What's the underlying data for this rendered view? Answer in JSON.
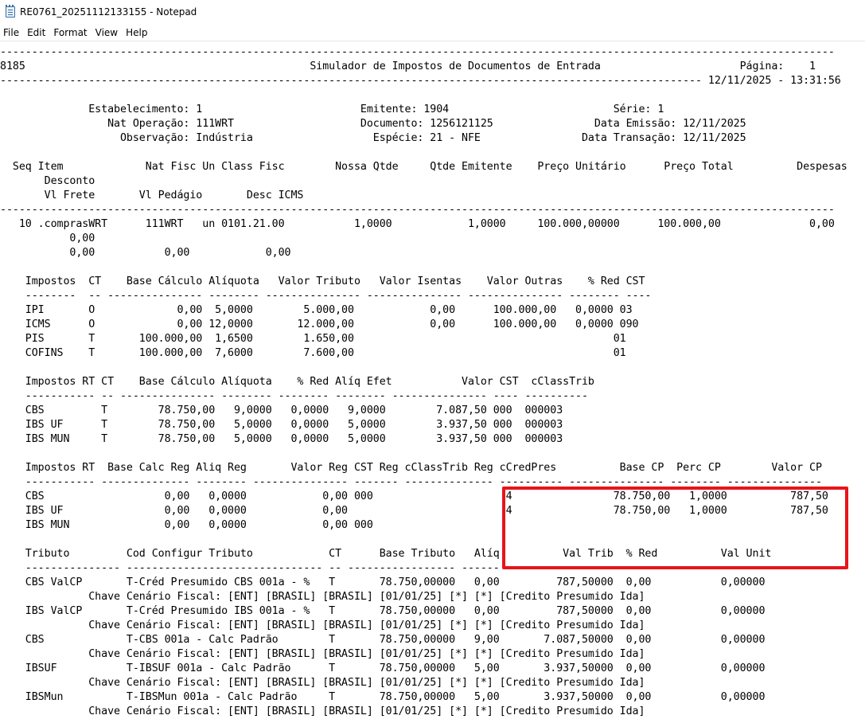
{
  "window": {
    "title": "RE0761_20251112133155 - Notepad"
  },
  "menu": {
    "items": [
      "File",
      "Edit",
      "Format",
      "View",
      "Help"
    ]
  },
  "document": {
    "lines": [
      "------------------------------------------------------------------------------------------------------------------------------------",
      "8185                                             Simulador de Impostos de Documentos de Entrada                      Página:    1",
      "--------------------------------------------------------------------------------------------------------------- 12/11/2025 - 13:31:56",
      "",
      "              Estabelecimento: 1                         Emitente: 1904                          Série: 1",
      "                 Nat Operação: 111WRT                    Documento: 1256121125                Data Emissão: 12/11/2025",
      "                   Observação: Indústria                   Espécie: 21 - NFE                Data Transação: 12/11/2025",
      "",
      "  Seq Item             Nat Fisc Un Class Fisc        Nossa Qtde     Qtde Emitente    Preço Unitário      Preço Total          Despesas",
      "       Desconto",
      "       Vl Frete       Vl Pedágio       Desc ICMS",
      "------------------------------------------------------------------------------------------------------------------------------------",
      "   10 .comprasWRT      111WRT   un 0101.21.00           1,0000            1,0000     100.000,00000      100.000,00              0,00",
      "           0,00",
      "           0,00           0,00            0,00",
      "",
      "    Impostos  CT    Base Cálculo Alíquota   Valor Tributo   Valor Isentas    Valor Outras    % Red CST",
      "    --------  -- --------------- -------- --------------- --------------- --------------- -------- ----",
      "    IPI       O             0,00  5,0000        5.000,00            0,00      100.000,00   0,0000 03",
      "    ICMS      O             0,00 12,0000       12.000,00            0,00      100.000,00   0,0000 090",
      "    PIS       T       100.000,00  1,6500        1.650,00                                         01",
      "    COFINS    T       100.000,00  7,6000        7.600,00                                         01",
      "",
      "    Impostos RT CT    Base Cálculo Alíquota    % Red Alíq Efet           Valor CST  cClassTrib",
      "    ----------- -- --------------- -------- -------- -------- --------------- ---- ----------",
      "    CBS         T        78.750,00   9,0000   0,0000   9,0000        7.087,50 000  000003",
      "    IBS UF      T        78.750,00   5,0000   0,0000   5,0000        3.937,50 000  000003",
      "    IBS MUN     T        78.750,00   5,0000   0,0000   5,0000        3.937,50 000  000003",
      "",
      "    Impostos RT  Base Calc Reg Aliq Reg       Valor Reg CST Reg cClassTrib Reg cCredPres          Base CP  Perc CP        Valor CP",
      "    ----------- -------------- -------- --------------- ------- -------------- ---------- --------------- -------- ---------------",
      "    CBS                   0,00   0,0000            0,00 000                     4                78.750,00   1,0000          787,50",
      "    IBS UF                0,00   0,0000            0,00                         4                78.750,00   1,0000          787,50",
      "    IBS MUN               0,00   0,0000            0,00 000",
      "",
      "    Tributo         Cod Configur Tributo            CT      Base Tributo   Alíq          Val Trib  % Red          Val Unit",
      "    --------------- ------------------------------- -- ----------------- ------ ----------------- ----- -----------------",
      "    CBS ValCP       T-Créd Presumido CBS 001a - %   T       78.750,00000   0,00         787,50000  0,00           0,00000",
      "              Chave Cenário Fiscal: [ENT] [BRASIL] [BRASIL] [01/01/25] [*] [*] [Credito Presumido Ida]",
      "    IBS ValCP       T-Créd Presumido IBS 001a - %   T       78.750,00000   0,00         787,50000  0,00           0,00000",
      "              Chave Cenário Fiscal: [ENT] [BRASIL] [BRASIL] [01/01/25] [*] [*] [Credito Presumido Ida]",
      "    CBS             T-CBS 001a - Calc Padrão        T       78.750,00000   9,00       7.087,50000  0,00           0,00000",
      "              Chave Cenário Fiscal: [ENT] [BRASIL] [BRASIL] [01/01/25] [*] [*] [Credito Presumido Ida]",
      "    IBSUF           T-IBSUF 001a - Calc Padrão      T       78.750,00000   5,00       3.937,50000  0,00           0,00000",
      "              Chave Cenário Fiscal: [ENT] [BRASIL] [BRASIL] [01/01/25] [*] [*] [Credito Presumido Ida]",
      "    IBSMun          T-IBSMun 001a - Calc Padrão     T       78.750,00000   5,00       3.937,50000  0,00           0,00000",
      "              Chave Cenário Fiscal: [ENT] [BRASIL] [BRASIL] [01/01/25] [*] [*] [Credito Presumido Ida]"
    ]
  }
}
